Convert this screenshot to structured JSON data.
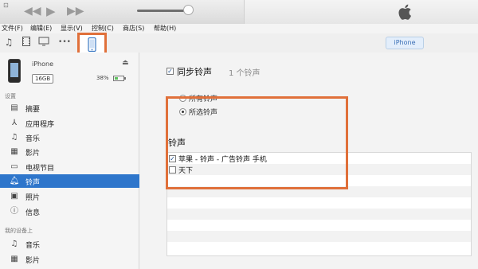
{
  "player": {
    "apple_logo": "apple-logo"
  },
  "menu": [
    {
      "label": "文件(F)"
    },
    {
      "label": "编辑(E)"
    },
    {
      "label": "显示(V)"
    },
    {
      "label": "控制(C)"
    },
    {
      "label": "商店(S)"
    },
    {
      "label": "帮助(H)"
    }
  ],
  "toolbar": {
    "more_label": "•••",
    "device_tab": "iPhone"
  },
  "device": {
    "name": "iPhone",
    "capacity": "16GB",
    "battery_pct": "38%",
    "battery_level": 0.38
  },
  "sidebar": {
    "settings_head": "设置",
    "settings_items": [
      {
        "label": "摘要",
        "icon": "summary-icon"
      },
      {
        "label": "应用程序",
        "icon": "apps-icon"
      },
      {
        "label": "音乐",
        "icon": "music-icon"
      },
      {
        "label": "影片",
        "icon": "film-icon"
      },
      {
        "label": "电视节目",
        "icon": "tv-icon"
      },
      {
        "label": "铃声",
        "icon": "bell-icon",
        "selected": true
      },
      {
        "label": "照片",
        "icon": "photo-icon"
      },
      {
        "label": "信息",
        "icon": "info-icon"
      }
    ],
    "ondevice_head": "我的设备上",
    "ondevice_items": [
      {
        "label": "音乐",
        "icon": "music-icon"
      },
      {
        "label": "影片",
        "icon": "film-icon"
      }
    ]
  },
  "main": {
    "sync_label": "同步铃声",
    "sync_count": "1 个铃声",
    "sync_checked": true,
    "radio_all": "所有铃声",
    "radio_selected": "所选铃声",
    "selected_option": "所选铃声",
    "ringtones_head": "铃声",
    "ringtones": [
      {
        "label": "苹果 - 铃声 - 广告铃声 手机",
        "checked": true
      },
      {
        "label": "天下",
        "checked": false
      }
    ]
  },
  "colors": {
    "accent_orange": "#e0703a",
    "selection_blue": "#2e76cb"
  }
}
